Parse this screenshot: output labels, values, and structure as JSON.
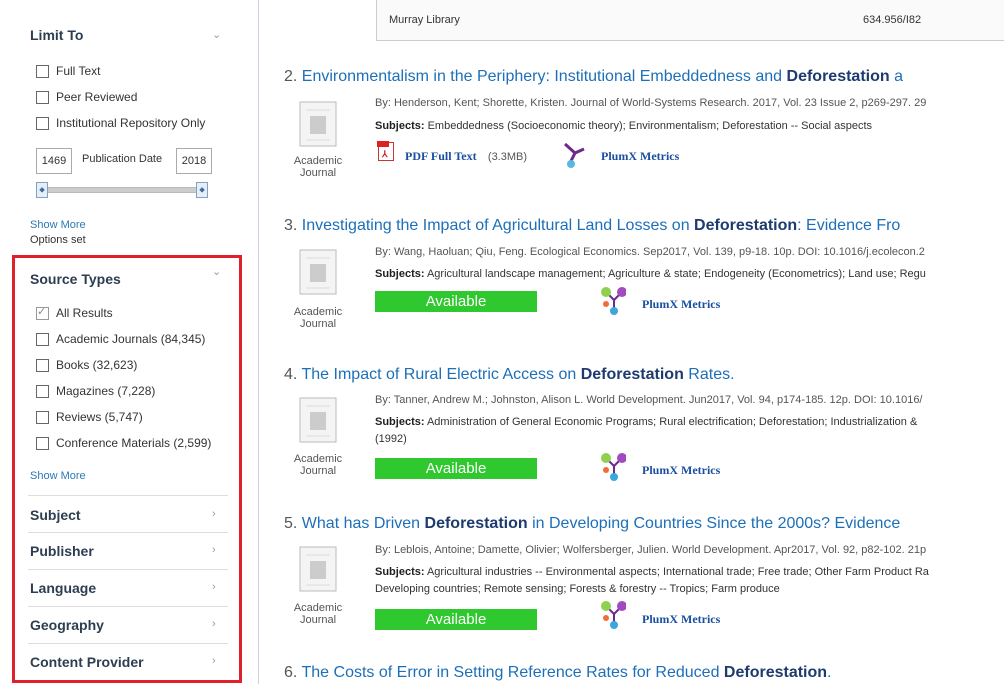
{
  "limit_to": {
    "heading": "Limit To",
    "options": [
      "Full Text",
      "Peer Reviewed",
      "Institutional Repository Only"
    ],
    "date_from": "1469",
    "date_label": "Publication Date",
    "date_to": "2018",
    "show_more": "Show More",
    "options_set": "Options set"
  },
  "source_types": {
    "heading": "Source Types",
    "items": [
      {
        "label": "All Results",
        "checked": true
      },
      {
        "label": "Academic Journals (84,345)",
        "checked": false
      },
      {
        "label": "Books (32,623)",
        "checked": false
      },
      {
        "label": "Magazines (7,228)",
        "checked": false
      },
      {
        "label": "Reviews (5,747)",
        "checked": false
      },
      {
        "label": "Conference Materials (2,599)",
        "checked": false
      }
    ],
    "show_more": "Show More"
  },
  "facets": [
    "Subject",
    "Publisher",
    "Language",
    "Geography",
    "Content Provider"
  ],
  "holdings": {
    "library": "Murray Library",
    "call_number": "634.956/I82"
  },
  "results": [
    {
      "num": "2.",
      "title_pre": "Environmentalism in the Periphery: Institutional Embeddedness and ",
      "title_bold": "Deforestation",
      "title_post": " a",
      "by": "By: Henderson, Kent; Shorette, Kristen. Journal of World-Systems Research. 2017, Vol. 23 Issue 2, p269-297. 29",
      "subjects": "Embeddedness (Socioeconomic theory); Environmentalism; Deforestation -- Social aspects",
      "subjects2": "",
      "type": "Academic Journal",
      "pdf": "PDF Full Text",
      "pdf_size": "(3.3MB)",
      "plumx": "PlumX Metrics"
    },
    {
      "num": "3.",
      "title_pre": "Investigating the Impact of Agricultural Land Losses on ",
      "title_bold": "Deforestation",
      "title_post": ": Evidence Fro",
      "by": "By: Wang, Haoluan; Qiu, Feng. Ecological Economics. Sep2017, Vol. 139, p9-18. 10p. DOI: 10.1016/j.ecolecon.2",
      "subjects": "Agricultural landscape management; Agriculture & state; Endogeneity (Econometrics); Land use; Regu",
      "subjects2": "",
      "type": "Academic Journal",
      "available": "Available",
      "plumx": "PlumX Metrics"
    },
    {
      "num": "4.",
      "title_pre": "The Impact of Rural Electric Access on ",
      "title_bold": "Deforestation",
      "title_post": " Rates.",
      "by": "By: Tanner, Andrew M.; Johnston, Alison L. World Development. Jun2017, Vol. 94, p174-185. 12p. DOI: 10.1016/",
      "subjects": "Administration of General Economic Programs; Rural electrification; Deforestation; Industrialization &",
      "subjects2": "(1992)",
      "type": "Academic Journal",
      "available": "Available",
      "plumx": "PlumX Metrics"
    },
    {
      "num": "5.",
      "title_pre": "What has Driven ",
      "title_bold": "Deforestation",
      "title_post": " in Developing Countries Since the 2000s? Evidence",
      "by": "By: Leblois, Antoine; Damette, Olivier; Wolfersberger, Julien. World Development. Apr2017, Vol. 92, p82-102. 21p",
      "subjects": "Agricultural industries -- Environmental aspects; International trade; Free trade; Other Farm Product Ra",
      "subjects2": "Developing countries; Remote sensing; Forests & forestry -- Tropics; Farm produce",
      "type": "Academic Journal",
      "available": "Available",
      "plumx": "PlumX Metrics"
    },
    {
      "num": "6.",
      "title_pre": "The Costs of Error in Setting Reference Rates for Reduced ",
      "title_bold": "Deforestation",
      "title_post": "."
    }
  ],
  "labels": {
    "subjects_prefix": "Subjects:"
  },
  "colors": {
    "highlight": "#e0202a",
    "available": "#2fc82f",
    "link": "#1c6fb8"
  }
}
